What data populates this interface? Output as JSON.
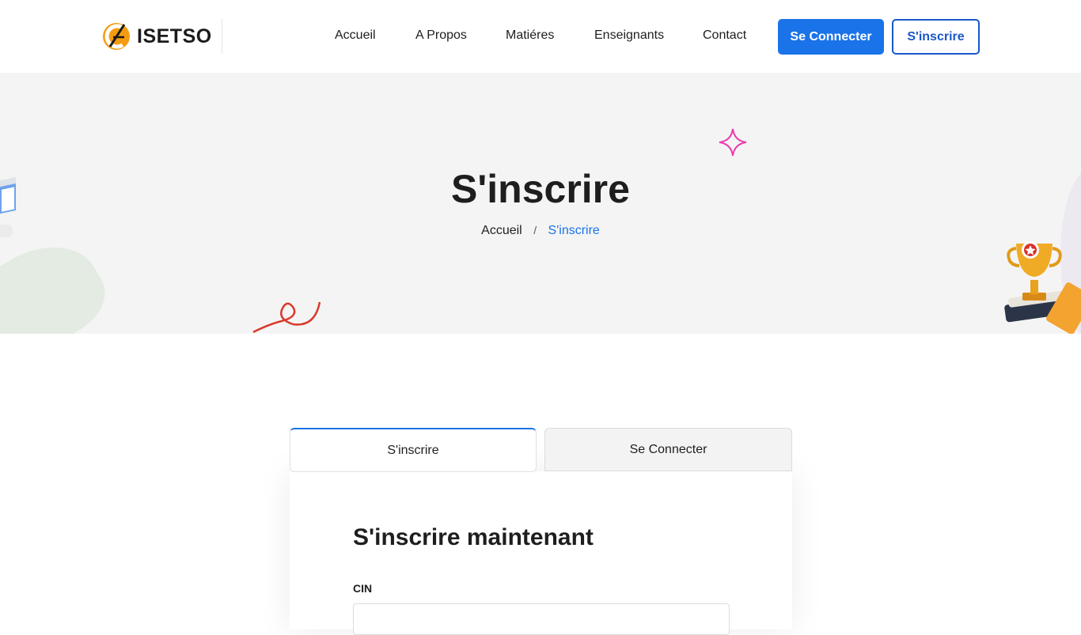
{
  "brand": {
    "name": "ISETSO",
    "accent": "#1a73e8",
    "logo_color": "#f39c12"
  },
  "nav": {
    "items": [
      {
        "label": "Accueil"
      },
      {
        "label": "A Propos"
      },
      {
        "label": "Matiéres"
      },
      {
        "label": "Enseignants"
      },
      {
        "label": "Contact"
      }
    ],
    "login_label": "Se Connecter",
    "signup_label": "S'inscrire"
  },
  "hero": {
    "title": "S'inscrire",
    "breadcrumb": {
      "home": "Accueil",
      "separator": "/",
      "current": "S'inscrire"
    }
  },
  "form": {
    "tabs": [
      {
        "label": "S'inscrire",
        "active": true
      },
      {
        "label": "Se Connecter",
        "active": false
      }
    ],
    "title": "S'inscrire maintenant",
    "fields": [
      {
        "label": "CIN",
        "value": "",
        "placeholder": ""
      }
    ]
  }
}
